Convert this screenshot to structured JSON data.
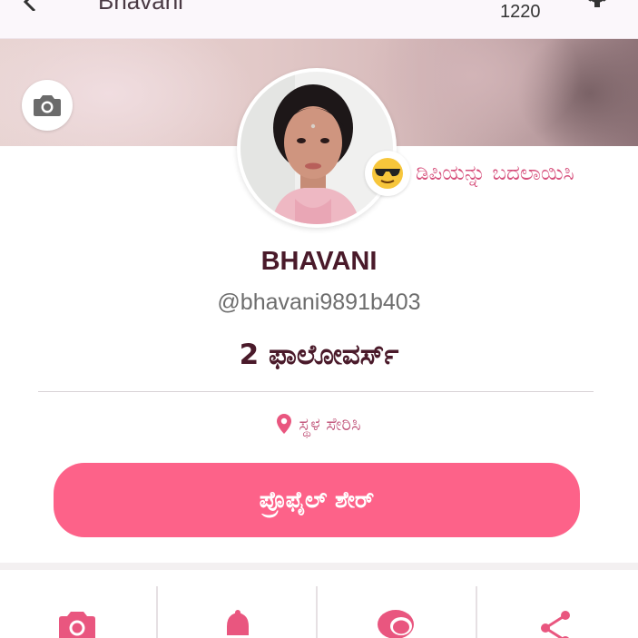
{
  "header": {
    "title": "Bhavani",
    "count": "1220",
    "icons": [
      "back-arrow-icon",
      "gear-icon"
    ]
  },
  "cover": {
    "camera_icon": "camera-icon"
  },
  "profile": {
    "change_dp_label": "ಡಿಪಿಯನ್ನು ಬದಲಾಯಿಸಿ",
    "change_dp_emoji": "😎",
    "name": "BHAVANI",
    "handle": "@bhavani9891b403",
    "followers": "2 ಫಾಲೋವರ್ಸ್",
    "location_label": "ಸ್ಥಳ ಸೇರಿಸಿ",
    "share_button": "ಪ್ರೊಫೈಲ್ ಶೇರ್"
  },
  "bottom_nav": {
    "items": [
      "camera-icon",
      "bell-icon",
      "chat-icon",
      "share-icon"
    ]
  },
  "colors": {
    "accent": "#fd6289",
    "accent_text": "#d64f7b",
    "name_text": "#4a1a2a"
  }
}
